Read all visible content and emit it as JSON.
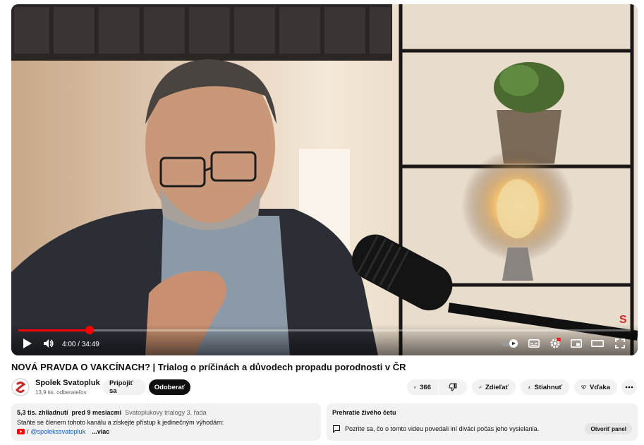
{
  "player": {
    "progress_fraction": 0.116,
    "time_current": "4:00",
    "time_separator": " / ",
    "time_total": "34:49",
    "watermark": "S"
  },
  "video": {
    "title": "NOVÁ PRAVDA O VAKCÍNACH? | Trialog o príčinách a důvodech propadu porodnosti v ČR"
  },
  "channel": {
    "name": "Spolek Svatopluk",
    "subscribers": "13,9 tis. odberateľov",
    "join_label": "Pripojiť sa",
    "subscribe_label": "Odoberať"
  },
  "actions": {
    "like_count": "366",
    "share_label": "Zdieľať",
    "download_label": "Stiahnuť",
    "thanks_label": "Vďaka"
  },
  "description": {
    "views": "5,3 tis. zhliadnutí",
    "age": "pred 9 mesiacmi",
    "playlist": "Svatoplukovy trialogy 3. řada",
    "text": "Staňte se členem tohoto kanálu a získejte přístup k jedinečným výhodám:",
    "link_prefix": "/",
    "link_handle": "@spolekssvatopluk",
    "more_label": "...viac"
  },
  "chat": {
    "title": "Prehratie živého četu",
    "text": "Pozrite sa, čo o tomto videu povedali iní diváci počas jeho vysielania.",
    "open_label": "Otvoriť panel"
  },
  "colors": {
    "accent": "#ff0000",
    "pill": "#f2f2f2",
    "dark": "#0f0f0f"
  }
}
